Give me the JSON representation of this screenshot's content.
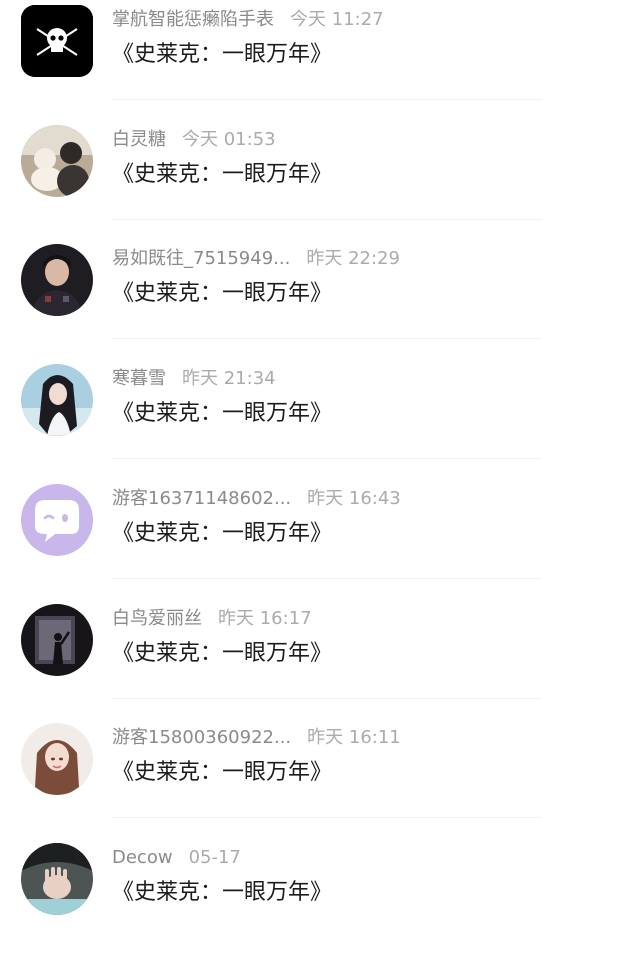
{
  "comments": [
    {
      "name": "掌航智能惩癞陷手表",
      "time": "今天 11:27",
      "text": "《史莱克：一眼万年》",
      "avatar": "skull-logo-avatar"
    },
    {
      "name": "白灵糖",
      "time": "今天 01:53",
      "text": "《史莱克：一眼万年》",
      "avatar": "girl-with-cat-avatar"
    },
    {
      "name": "易如既往_7515949...",
      "time": "昨天 22:29",
      "text": "《史莱克：一眼万年》",
      "avatar": "man-portrait-avatar"
    },
    {
      "name": "寒暮雪",
      "time": "昨天 21:34",
      "text": "《史莱克：一眼万年》",
      "avatar": "anime-girl-avatar"
    },
    {
      "name": "游客16371148602...",
      "time": "昨天 16:43",
      "text": "《史莱克：一眼万年》",
      "avatar": "default-chat-bubble-avatar"
    },
    {
      "name": "白鸟爱丽丝",
      "time": "昨天 16:17",
      "text": "《史莱克：一眼万年》",
      "avatar": "silhouette-avatar"
    },
    {
      "name": "游客15800360922...",
      "time": "昨天 16:11",
      "text": "《史莱克：一眼万年》",
      "avatar": "girl-portrait-avatar"
    },
    {
      "name": "Decow",
      "time": "05-17",
      "text": "《史莱克：一眼万年》",
      "avatar": "hand-photo-avatar"
    }
  ],
  "colors": {
    "name": "#8a8a8a",
    "time": "#ababab",
    "message": "#1c1c1c",
    "default_avatar_bg": "#c9b6ea"
  }
}
